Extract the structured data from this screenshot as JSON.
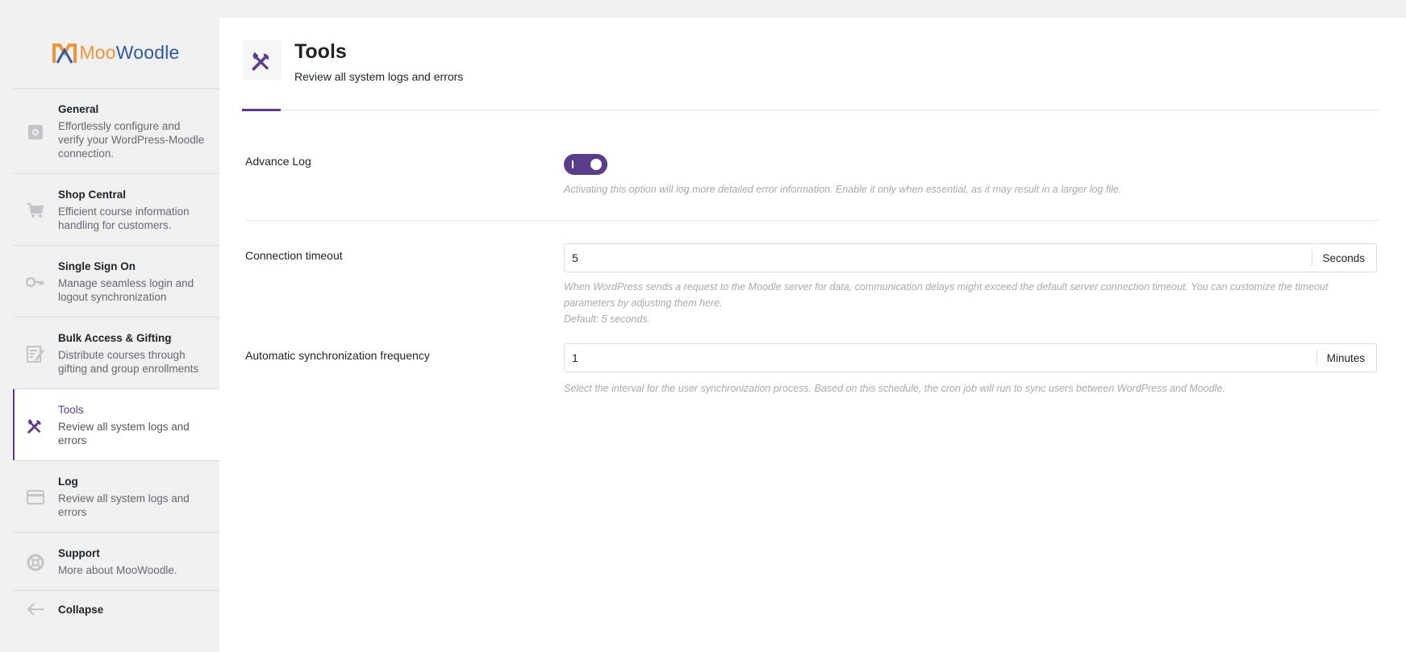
{
  "brand": {
    "name_part1": "Moo",
    "name_part2": "Woodle"
  },
  "sidebar": {
    "items": [
      {
        "title": "General",
        "description": "Effortlessly configure and verify your WordPress-Moodle connection.",
        "icon": "gear-icon"
      },
      {
        "title": "Shop Central",
        "description": "Efficient course information handling for customers.",
        "icon": "cart-icon"
      },
      {
        "title": "Single Sign On",
        "description": "Manage seamless login and logout synchronization",
        "icon": "key-icon"
      },
      {
        "title": "Bulk Access & Gifting",
        "description": "Distribute courses through gifting and group enrollments",
        "icon": "edit-icon"
      },
      {
        "title": "Tools",
        "description": "Review all system logs and errors",
        "icon": "tools-icon",
        "active": true
      },
      {
        "title": "Log",
        "description": "Review all system logs and errors",
        "icon": "card-icon"
      },
      {
        "title": "Support",
        "description": "More about MooWoodle.",
        "icon": "lifebuoy-icon"
      }
    ],
    "collapse_label": "Collapse"
  },
  "header": {
    "title": "Tools",
    "subtitle": "Review all system logs and errors"
  },
  "settings": {
    "advance_log": {
      "label": "Advance Log",
      "enabled": true,
      "description": "Activating this option will log more detailed error information. Enable it only when essential, as it may result in a larger log file."
    },
    "connection_timeout": {
      "label": "Connection timeout",
      "value": "5",
      "unit": "Seconds",
      "description_line1": "When WordPress sends a request to the Moodle server for data, communication delays might exceed the default server connection timeout. You can customize the timeout",
      "description_line2": "parameters by adjusting them here.",
      "default_note": "Default: 5 seconds."
    },
    "sync_frequency": {
      "label": "Automatic synchronization frequency",
      "value": "1",
      "unit": "Minutes",
      "description": "Select the interval for the user synchronization process. Based on this schedule, the cron job will run to sync users between WordPress and Moodle."
    }
  },
  "colors": {
    "accent": "#5a3d8a",
    "brand_orange": "#f0923a",
    "brand_blue": "#2e5aa6"
  }
}
